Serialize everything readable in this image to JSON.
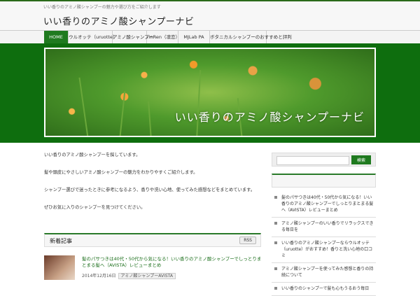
{
  "header": {
    "tagline": "いい香りのアミノ酸シャンプーの魅力や選び方をご紹介します",
    "site_title": "いい香りのアミノ酸シャンプーナビ"
  },
  "nav": {
    "items": [
      {
        "label": "HOME",
        "active": true
      },
      {
        "label": "ウルオッテ（uruotte）"
      },
      {
        "label": "アミノ酸シャンプー"
      },
      {
        "label": "rinRen（凛恋）"
      },
      {
        "label": "MJLab PA"
      },
      {
        "label": "ボタニカルシャンプーのおすすめと評判"
      }
    ]
  },
  "hero": {
    "text": "いい香りのアミノ酸シャンプーナビ"
  },
  "intro": {
    "paragraphs": [
      "いい香りのアミノ酸シャンプーを探しています。",
      "髪や頭皮にやさしいアミノ酸シャンプーの魅力をわかりやすくご紹介します。",
      "シャンプー選びで迷ったときに参考になるよう、香りや洗い心地、使ってみた感想などをまとめています。",
      "ぜひお気に入りのシャンプーを見つけてください。"
    ]
  },
  "recent": {
    "title": "新着記事",
    "rss_label": "RSS",
    "posts": [
      {
        "title": "髪のパサつきは40代・50代から気になる！いい香りのアミノ酸シャンプーでしっとりまとまる髪へ（AVISTA）レビューまとめ",
        "date": "2014年12月16日",
        "category": "アミノ酸シャンプーAVISTA"
      }
    ]
  },
  "sidebar": {
    "search_placeholder": "",
    "search_button": "検索",
    "heading": "",
    "items": [
      "髪のパサつきは40代・50代から気になる！いい香りのアミノ酸シャンプーでしっとりまとまる髪へ（AVISTA）レビューまとめ",
      "アミノ酸シャンプーのいい香りでリラックスできる毎日を",
      "いい香りのアミノ酸シャンプーならウルオッテ（uruotte）がおすすめ！香りと洗い心地の口コミ",
      "アミノ酸シャンプーを使ってみた感想と香りの持続について",
      "いい香りのシャンプーで髪も心もうるおう毎日"
    ]
  },
  "colors": {
    "brand_green": "#1f7a1f",
    "hero_band": "#0e6e0e",
    "link_green": "#1a6e1a"
  }
}
